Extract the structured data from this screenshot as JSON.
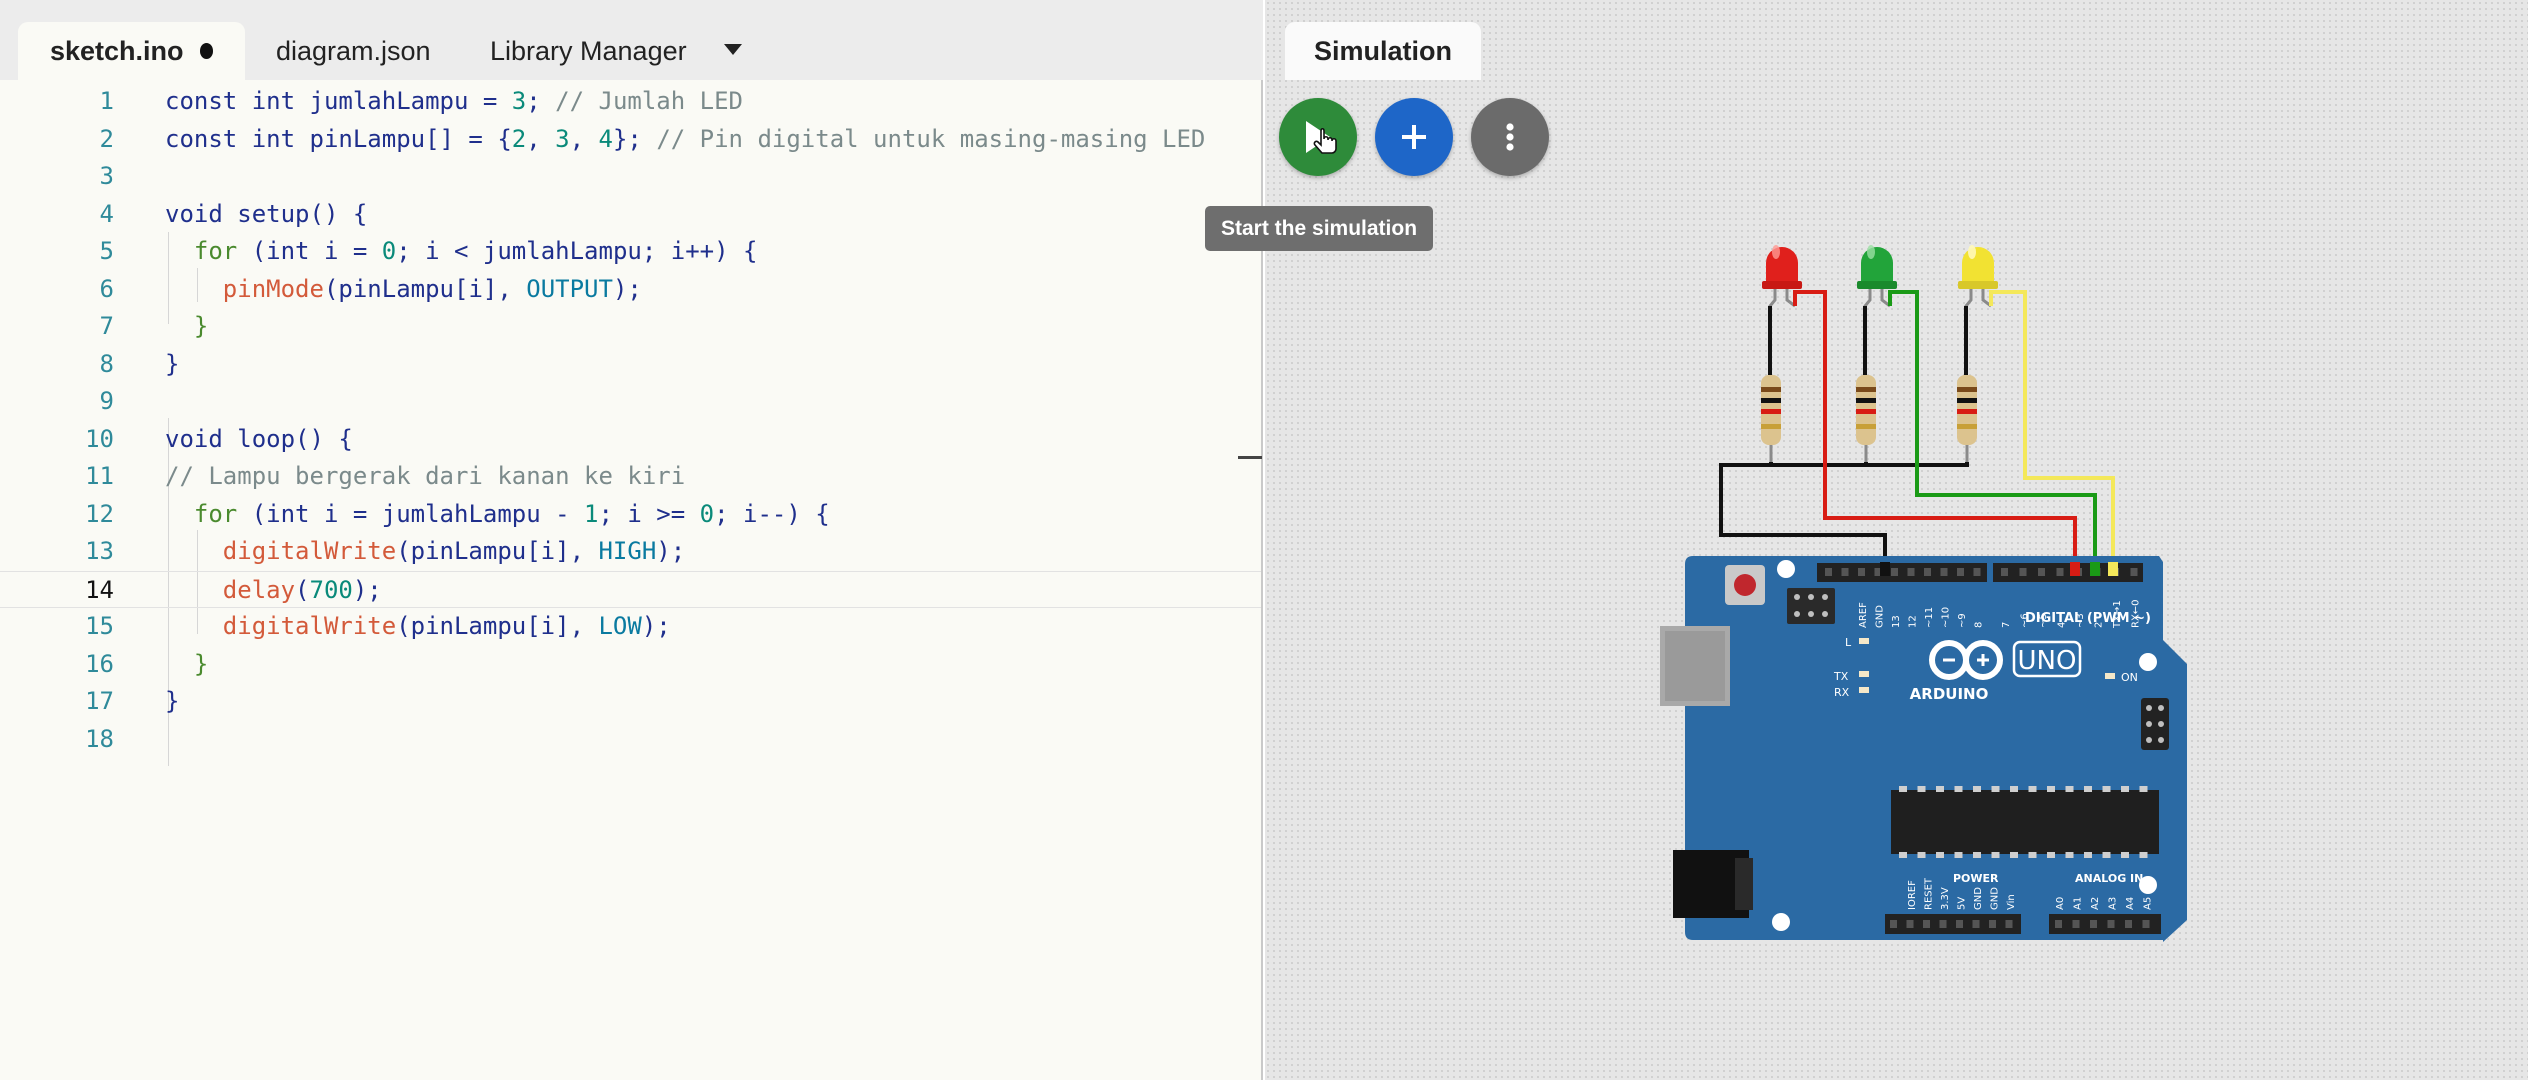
{
  "editor": {
    "tabs": [
      {
        "label": "sketch.ino",
        "active": true,
        "modified": true
      },
      {
        "label": "diagram.json",
        "active": false
      },
      {
        "label": "Library Manager",
        "active": false
      }
    ],
    "current_line": 14,
    "lines": [
      {
        "n": "1",
        "segs": [
          [
            "const int jumlahLampu = ",
            "k"
          ],
          [
            "3",
            "n"
          ],
          [
            "; ",
            "k"
          ],
          [
            "// Jumlah LED",
            "c"
          ]
        ]
      },
      {
        "n": "2",
        "segs": [
          [
            "const int pinLampu[] = {",
            "k"
          ],
          [
            "2",
            "n"
          ],
          [
            ", ",
            "k"
          ],
          [
            "3",
            "n"
          ],
          [
            ", ",
            "k"
          ],
          [
            "4",
            "n"
          ],
          [
            "}; ",
            "k"
          ],
          [
            "// Pin digital untuk masing-masing LED",
            "c"
          ]
        ]
      },
      {
        "n": "3",
        "segs": []
      },
      {
        "n": "4",
        "segs": [
          [
            "void setup() {",
            "k"
          ]
        ]
      },
      {
        "n": "5",
        "segs": [
          [
            "  for ",
            "kw"
          ],
          [
            "(int i = ",
            "k"
          ],
          [
            "0",
            "n"
          ],
          [
            "; i < jumlahLampu; i++) {",
            "k"
          ]
        ]
      },
      {
        "n": "6",
        "segs": [
          [
            "    ",
            "k"
          ],
          [
            "pinMode",
            "f"
          ],
          [
            "(pinLampu[i], ",
            "k"
          ],
          [
            "OUTPUT",
            "cst"
          ],
          [
            ");",
            "k"
          ]
        ]
      },
      {
        "n": "7",
        "segs": [
          [
            "  }",
            "kw"
          ]
        ]
      },
      {
        "n": "8",
        "segs": [
          [
            "}",
            "k"
          ]
        ]
      },
      {
        "n": "9",
        "segs": []
      },
      {
        "n": "10",
        "segs": [
          [
            "void loop() {",
            "k"
          ]
        ]
      },
      {
        "n": "11",
        "segs": [
          [
            "// Lampu bergerak dari kanan ke kiri",
            "c"
          ]
        ]
      },
      {
        "n": "12",
        "segs": [
          [
            "  for ",
            "kw"
          ],
          [
            "(int i = jumlahLampu - ",
            "k"
          ],
          [
            "1",
            "n"
          ],
          [
            "; i >= ",
            "k"
          ],
          [
            "0",
            "n"
          ],
          [
            "; i--) {",
            "k"
          ]
        ]
      },
      {
        "n": "13",
        "segs": [
          [
            "    ",
            "k"
          ],
          [
            "digitalWrite",
            "f"
          ],
          [
            "(pinLampu[i], ",
            "k"
          ],
          [
            "HIGH",
            "cst"
          ],
          [
            ");",
            "k"
          ]
        ]
      },
      {
        "n": "14",
        "segs": [
          [
            "    ",
            "k"
          ],
          [
            "delay",
            "f"
          ],
          [
            "(",
            "k"
          ],
          [
            "700",
            "n"
          ],
          [
            ");",
            "k"
          ]
        ]
      },
      {
        "n": "15",
        "segs": [
          [
            "    ",
            "k"
          ],
          [
            "digitalWrite",
            "f"
          ],
          [
            "(pinLampu[i], ",
            "k"
          ],
          [
            "LOW",
            "cst"
          ],
          [
            ");",
            "k"
          ]
        ]
      },
      {
        "n": "16",
        "segs": [
          [
            "  }",
            "kw"
          ]
        ]
      },
      {
        "n": "17",
        "segs": [
          [
            "}",
            "k"
          ]
        ]
      },
      {
        "n": "18",
        "segs": []
      }
    ]
  },
  "simulation": {
    "tab_label": "Simulation",
    "start_tooltip": "Start the simulation",
    "buttons": {
      "start_icon": "play-icon",
      "add_icon": "plus-icon",
      "more_icon": "kebab-menu-icon"
    },
    "leds": [
      {
        "color": "red",
        "hex": "#e0201c",
        "wire_hex": "#d81c14",
        "pin": "4"
      },
      {
        "color": "green",
        "hex": "#22a43a",
        "wire_hex": "#1a9a16",
        "pin": "3"
      },
      {
        "color": "yellow",
        "hex": "#f2e232",
        "wire_hex": "#f4e85a",
        "pin": "2"
      }
    ],
    "board": {
      "brand": "ARDUINO",
      "model": "UNO",
      "board_color": "#2b6aa4",
      "digital_header_label": "DIGITAL (PWM ~)",
      "digital_pins": [
        "AREF",
        "GND",
        "13",
        "12",
        "~11",
        "~10",
        "~9",
        "8",
        "7",
        "~6",
        "~5",
        "4",
        "~3",
        "2",
        "TX→1",
        "RX←0"
      ],
      "led_labels": [
        "L",
        "TX",
        "RX",
        "ON"
      ],
      "power_header_label": "POWER",
      "power_pins": [
        "IOREF",
        "RESET",
        "3.3V",
        "5V",
        "GND",
        "GND",
        "Vin"
      ],
      "analog_header_label": "ANALOG IN",
      "analog_pins": [
        "A0",
        "A1",
        "A2",
        "A3",
        "A4",
        "A5"
      ]
    }
  }
}
